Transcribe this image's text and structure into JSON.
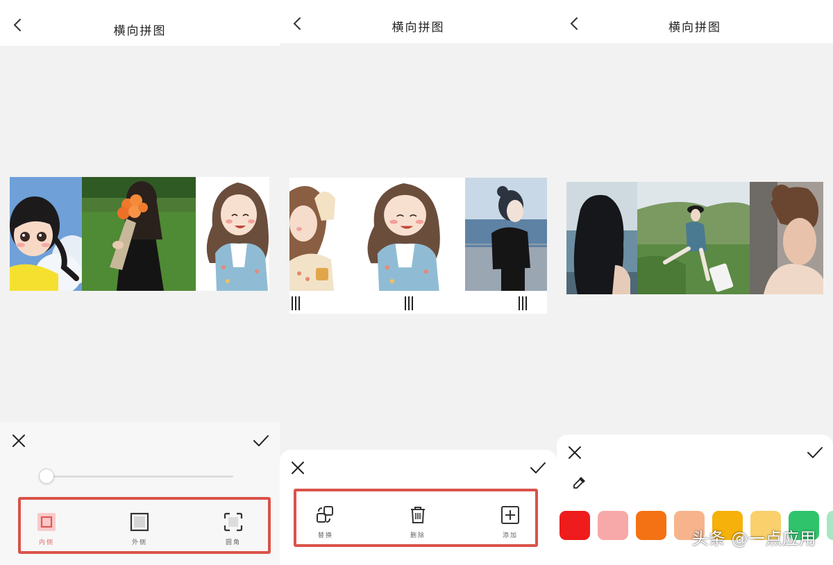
{
  "screens": [
    {
      "header": {
        "title": "横向拼图"
      },
      "sheet": {
        "tools": [
          {
            "label": "内侧",
            "icon": "inner-border-icon",
            "active": true
          },
          {
            "label": "外侧",
            "icon": "outer-border-icon",
            "active": false
          },
          {
            "label": "圆角",
            "icon": "rounded-corner-icon",
            "active": false
          }
        ],
        "slider_value": 0
      }
    },
    {
      "header": {
        "title": "横向拼图"
      },
      "sheet": {
        "tools": [
          {
            "label": "替换",
            "icon": "replace-icon"
          },
          {
            "label": "删除",
            "icon": "trash-icon"
          },
          {
            "label": "添加",
            "icon": "add-icon"
          }
        ]
      }
    },
    {
      "header": {
        "title": "横向拼图"
      },
      "sheet": {
        "colors": [
          "#ee1c1c",
          "#f7a8a8",
          "#f47213",
          "#f7b48c",
          "#f6b10a",
          "#f9d06b",
          "#2fc46b",
          "#a8e6c4"
        ]
      }
    }
  ],
  "colors": {
    "highlight": "#d9534a",
    "active_tool": "#e46a6a",
    "background": "#f2f2f2"
  },
  "watermark": "头条 @一点应用"
}
